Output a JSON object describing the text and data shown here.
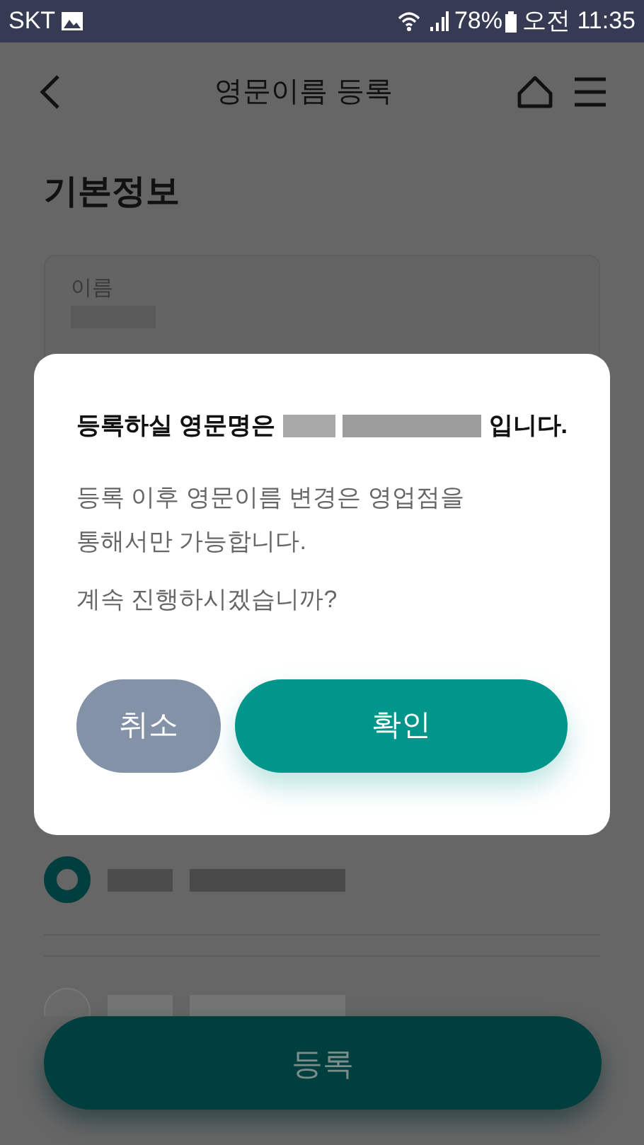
{
  "status_bar": {
    "carrier": "SKT",
    "battery": "78%",
    "time": "오전 11:35"
  },
  "header": {
    "title": "영문이름 등록"
  },
  "section": {
    "title": "기본정보"
  },
  "name_field": {
    "label": "이름"
  },
  "options": [
    {
      "selected": true
    },
    {
      "selected": false
    }
  ],
  "register_button": {
    "label": "등록"
  },
  "dialog": {
    "message_start": "등록하실 영문명은",
    "message_end": "입니다.",
    "body": "등록 이후 영문이름 변경은 영업점을 통해서만 가능합니다.",
    "question": "계속 진행하시겠습니까?",
    "cancel": "취소",
    "confirm": "확인"
  }
}
